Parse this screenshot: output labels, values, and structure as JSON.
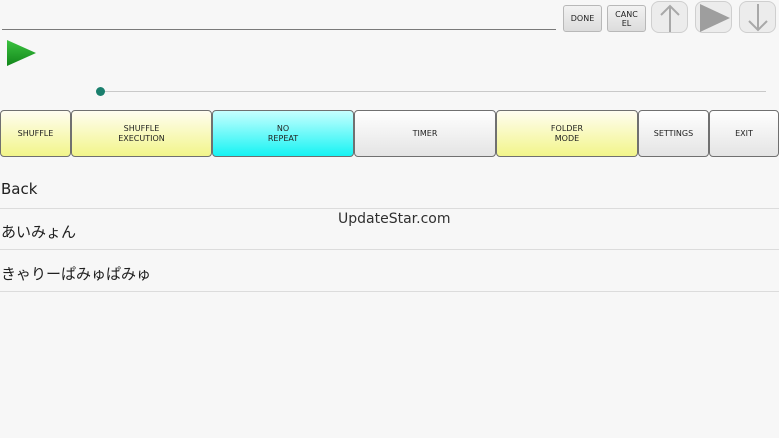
{
  "header": {
    "done_label": "DONE",
    "cancel_label": "CANC\nEL"
  },
  "icons": {
    "up": "arrow-up-icon",
    "play": "play-icon",
    "down": "arrow-down-icon",
    "play_big": "play-icon"
  },
  "colors": {
    "play_green": "#1a9a22",
    "slider_accent": "#1a7f6d",
    "button_yellow": "#f2f58a",
    "button_cyan": "#17f3f3"
  },
  "toolbar": {
    "shuffle": "SHUFFLE",
    "shuffle_execution": "SHUFFLE\nEXECUTION",
    "no_repeat": "NO\nREPEAT",
    "timer": "TIMER",
    "folder_mode": "FOLDER\nMODE",
    "settings": "SETTINGS",
    "exit": "EXIT"
  },
  "list": {
    "items": [
      {
        "label": "Back"
      },
      {
        "label": "あいみょん"
      },
      {
        "label": "きゃりーぱみゅぱみゅ"
      }
    ]
  },
  "watermark": "UpdateStar.com"
}
